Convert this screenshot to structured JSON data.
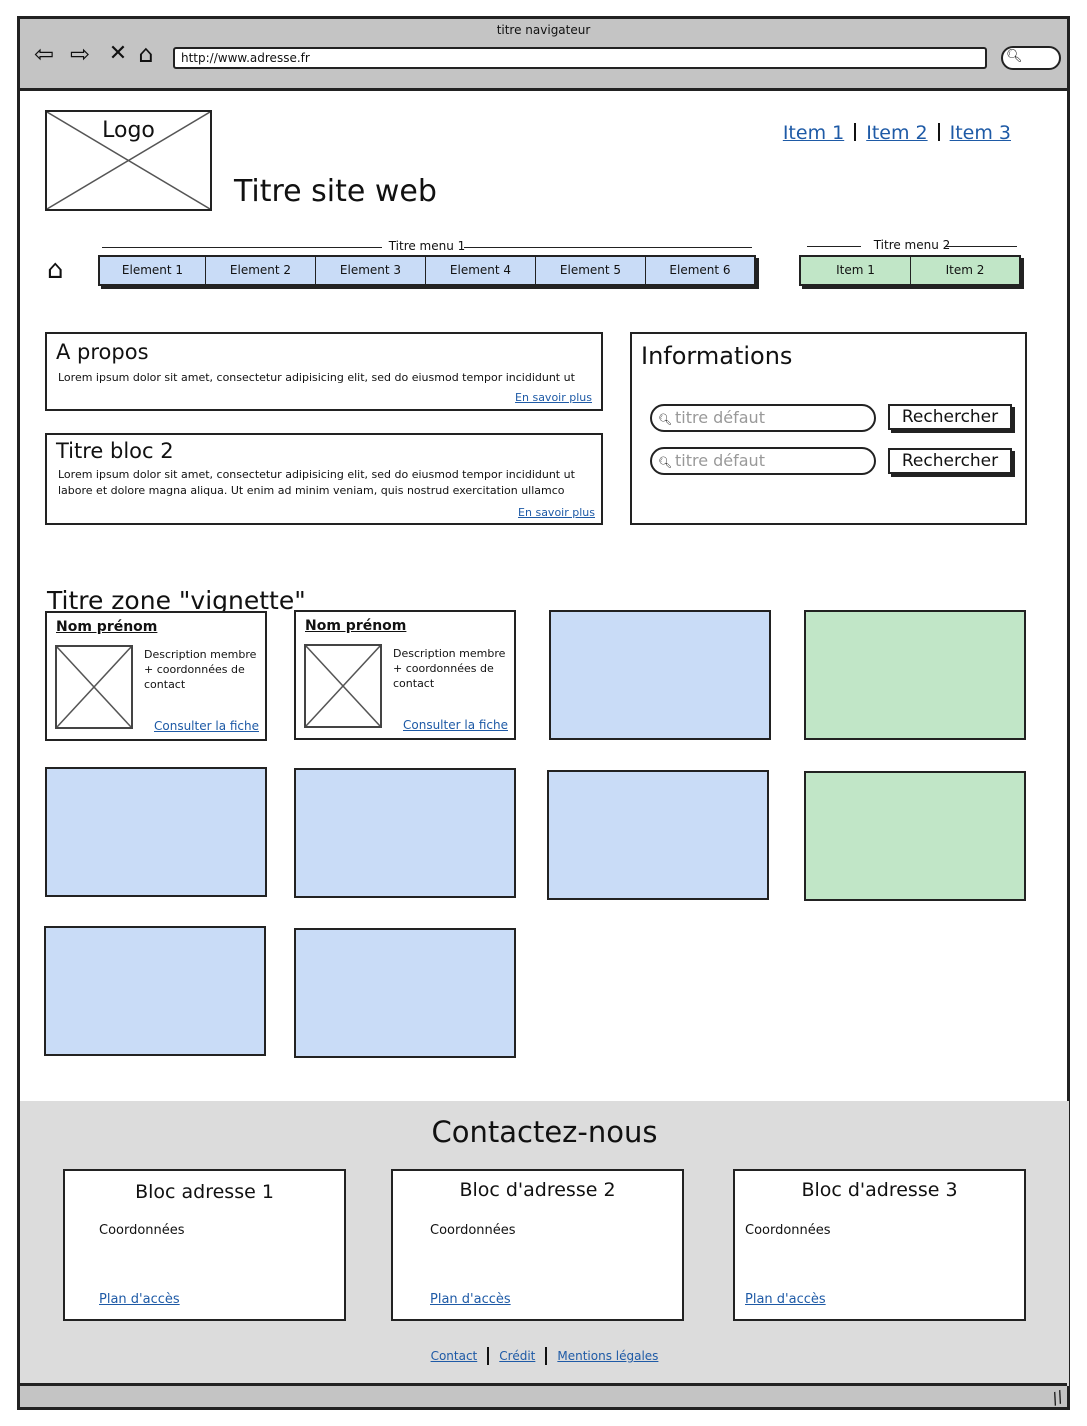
{
  "browser": {
    "title": "titre navigateur",
    "url": "http://www.adresse.fr"
  },
  "header": {
    "logo_label": "Logo",
    "site_title": "Titre site web",
    "top_nav": [
      "Item 1",
      "Item 2",
      "Item 3"
    ]
  },
  "menu1": {
    "title": "Titre menu 1",
    "items": [
      "Element 1",
      "Element 2",
      "Element 3",
      "Element 4",
      "Element 5",
      "Element 6"
    ]
  },
  "menu2": {
    "title": "Titre menu 2",
    "items": [
      "Item 1",
      "Item 2"
    ]
  },
  "about": {
    "title": "A propos",
    "text": "Lorem ipsum dolor sit amet, consectetur adipisicing elit, sed do eiusmod tempor incididunt ut",
    "more": "En savoir plus"
  },
  "block2": {
    "title": "Titre bloc 2",
    "text": "Lorem ipsum dolor sit amet, consectetur adipisicing elit, sed do eiusmod tempor incididunt ut labore et dolore magna aliqua. Ut enim ad minim veniam, quis nostrud exercitation ullamco",
    "more": "En savoir plus"
  },
  "info": {
    "title": "Informations",
    "searches": [
      {
        "placeholder": "titre défaut",
        "button": "Rechercher"
      },
      {
        "placeholder": "titre défaut",
        "button": "Rechercher"
      }
    ]
  },
  "vignettes": {
    "title": "Titre zone \"vignette\"",
    "members": [
      {
        "name": "Nom prénom",
        "desc": "Description membre + coordonnées de contact",
        "link": "Consulter la fiche"
      },
      {
        "name": "Nom prénom",
        "desc": "Description membre + coordonnées de contact",
        "link": "Consulter la fiche"
      }
    ]
  },
  "footer": {
    "title": "Contactez-nous",
    "blocks": [
      {
        "title": "Bloc adresse 1",
        "coord": "Coordonnées",
        "plan": "Plan d'accès"
      },
      {
        "title": "Bloc d'adresse 2",
        "coord": "Coordonnées",
        "plan": "Plan d'accès"
      },
      {
        "title": "Bloc d'adresse 3",
        "coord": "Coordonnées",
        "plan": "Plan d'accès"
      }
    ],
    "links": [
      "Contact",
      "Crédit",
      "Mentions légales"
    ]
  },
  "colors": {
    "blue_fill": "#c9dcf7",
    "green_fill": "#c1e6c7",
    "link": "#1e5aa6",
    "chrome": "#c4c4c4",
    "footer_bg": "#dcdcdc"
  }
}
